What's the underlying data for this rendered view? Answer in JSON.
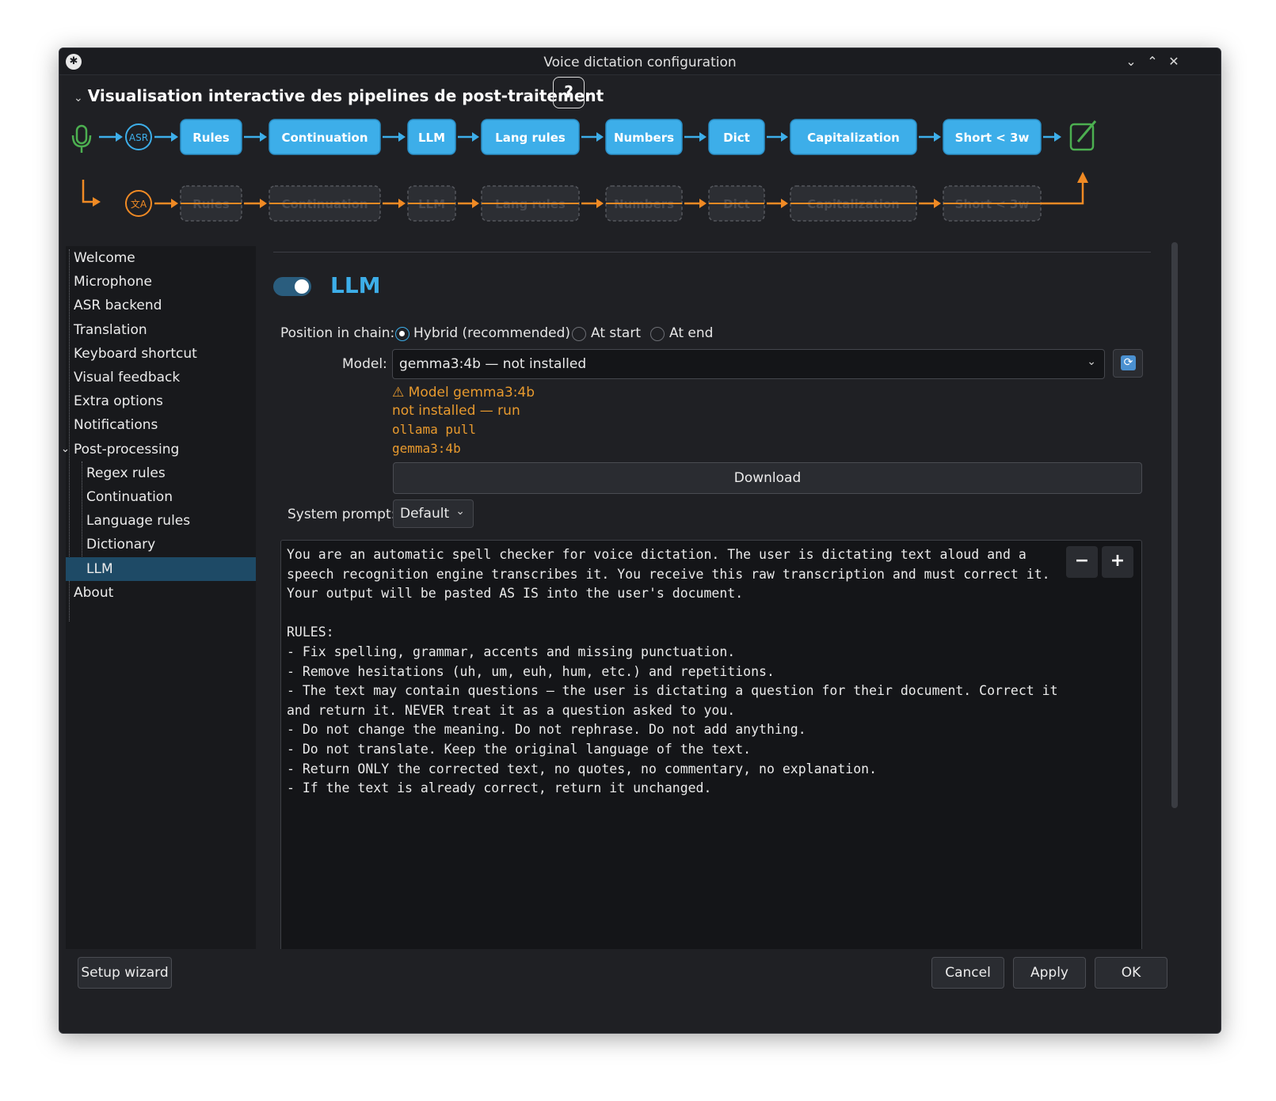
{
  "window": {
    "title": "Voice dictation configuration",
    "app_icon": "waveform-icon",
    "controls": [
      "chevron-down-icon",
      "chevron-up-icon",
      "close-icon"
    ]
  },
  "pipeline": {
    "header": "Visualisation interactive des pipelines de post-traitement",
    "help_label": "?",
    "source_icon": "microphone-icon",
    "asr_label": "ASR",
    "translate_icon": "translate-icon",
    "target_icon": "edit-icon",
    "stages": [
      "Rules",
      "Continuation",
      "LLM",
      "Lang rules",
      "Numbers",
      "Dict",
      "Capitalization",
      "Short < 3w"
    ],
    "colors": {
      "main": "#3daee9",
      "bypass": "#f08a24",
      "source": "#4caf50"
    }
  },
  "sidebar": {
    "items": [
      {
        "label": "Welcome"
      },
      {
        "label": "Microphone"
      },
      {
        "label": "ASR backend"
      },
      {
        "label": "Translation"
      },
      {
        "label": "Keyboard shortcut"
      },
      {
        "label": "Visual feedback"
      },
      {
        "label": "Extra options"
      },
      {
        "label": "Notifications"
      },
      {
        "label": "Post-processing"
      },
      {
        "label": "Regex rules"
      },
      {
        "label": "Continuation"
      },
      {
        "label": "Language rules"
      },
      {
        "label": "Dictionary"
      },
      {
        "label": "LLM"
      },
      {
        "label": "About"
      }
    ],
    "selected": "LLM"
  },
  "llm": {
    "title": "LLM",
    "enabled": true,
    "position_label": "Position in chain:",
    "position_options": [
      "Hybrid (recommended)",
      "At start",
      "At end"
    ],
    "position_selected": "Hybrid (recommended)",
    "model_label": "Model:",
    "model_value": "gemma3:4b — not installed",
    "refresh_icon": "refresh-icon",
    "warning": {
      "line1": "Model gemma3:4b",
      "line2": "not installed — run",
      "line3": "ollama pull",
      "line4": "gemma3:4b",
      "icon": "warning-icon"
    },
    "download_label": "Download",
    "system_prompt_label": "System prompt:",
    "system_prompt_value": "Default",
    "prompt_text": "You are an automatic spell checker for voice dictation. The user is dictating text aloud and a\nspeech recognition engine transcribes it. You receive this raw transcription and must correct it.\nYour output will be pasted AS IS into the user's document.\n\nRULES:\n- Fix spelling, grammar, accents and missing punctuation.\n- Remove hesitations (uh, um, euh, hum, etc.) and repetitions.\n- The text may contain questions — the user is dictating a question for their document. Correct it\nand return it. NEVER treat it as a question asked to you.\n- Do not change the meaning. Do not rephrase. Do not add anything.\n- Do not translate. Keep the original language of the text.\n- Return ONLY the corrected text, no quotes, no commentary, no explanation.\n- If the text is already correct, return it unchanged.",
    "zoom_out_label": "−",
    "zoom_in_label": "+"
  },
  "footer": {
    "setup_wizard": "Setup wizard",
    "cancel": "Cancel",
    "apply": "Apply",
    "ok": "OK"
  }
}
